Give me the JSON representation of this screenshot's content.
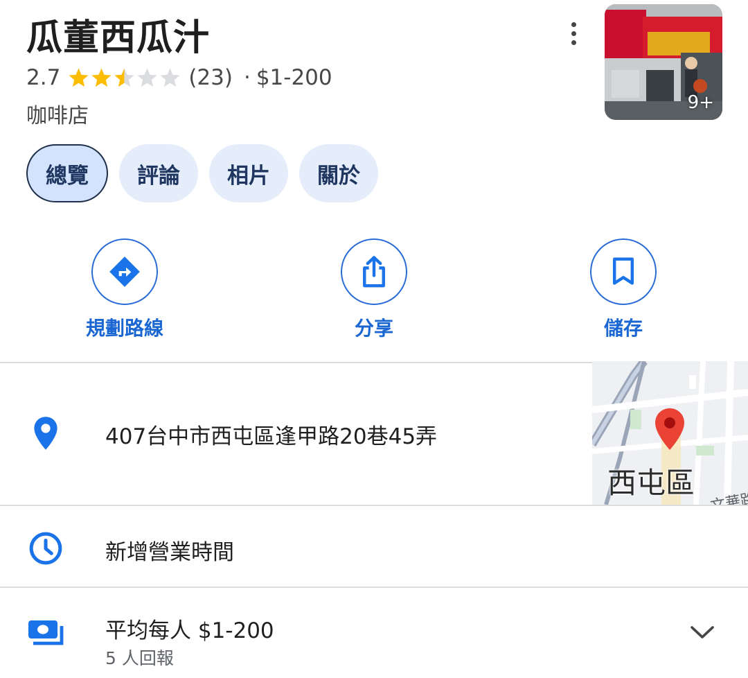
{
  "place": {
    "name": "瓜董西瓜汁",
    "rating": "2.7",
    "rating_value": 2.7,
    "stars_max": 5,
    "review_count": "(23)",
    "separator": "·",
    "price_range": "$1-200",
    "category": "咖啡店"
  },
  "thumbnail": {
    "more_count": "9+"
  },
  "tabs": [
    {
      "label": "總覽",
      "active": true
    },
    {
      "label": "評論",
      "active": false
    },
    {
      "label": "相片",
      "active": false
    },
    {
      "label": "關於",
      "active": false
    }
  ],
  "actions": {
    "directions": {
      "label": "規劃路線",
      "icon": "directions-icon"
    },
    "share": {
      "label": "分享",
      "icon": "share-icon"
    },
    "save": {
      "label": "儲存",
      "icon": "bookmark-icon"
    }
  },
  "info": {
    "address": "407台中市西屯區逢甲路20巷45弄",
    "hours": "新增營業時間",
    "price_title": "平均每人 $1-200",
    "price_reports": "5 人回報"
  },
  "minimap": {
    "district_label": "西屯區",
    "road_label": "文華路"
  },
  "colors": {
    "accent_blue": "#1a73e8",
    "star_gold": "#fbbc04",
    "star_empty": "#dadce0",
    "tab_bg": "#e5edfb",
    "map_pin_red": "#ea4335"
  }
}
